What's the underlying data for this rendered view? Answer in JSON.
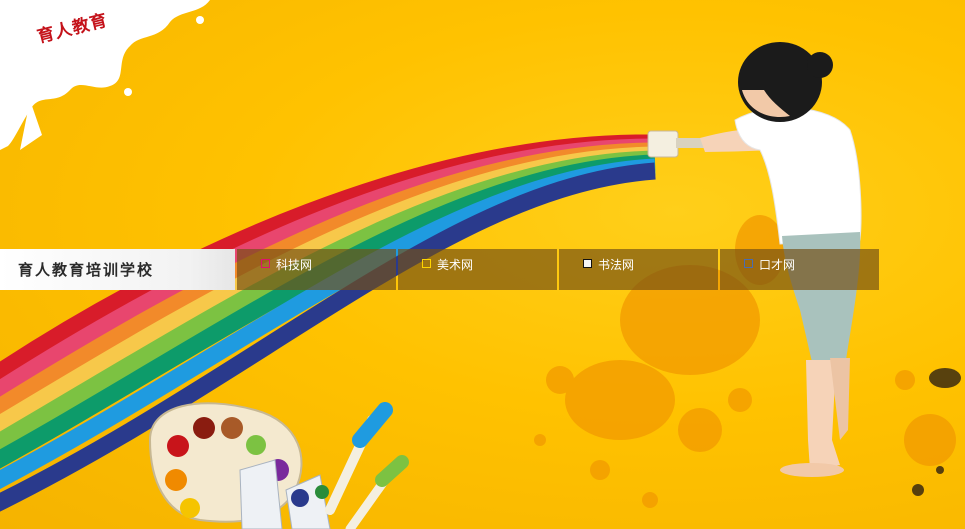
{
  "logo": {
    "text": "育人教育"
  },
  "header": {
    "school_name": "育人教育培训学校"
  },
  "nav": {
    "items": [
      {
        "label": "科技网",
        "marker_color": "#e0106e"
      },
      {
        "label": "美术网",
        "marker_color": "#ffd400"
      },
      {
        "label": "书法网",
        "marker_color": "#111111"
      },
      {
        "label": "口才网",
        "marker_color": "#4a6cb0"
      }
    ]
  },
  "colors": {
    "background": "#ffc200",
    "nav_overlay": "#735014",
    "logo_red": "#c4121a"
  },
  "illustration": {
    "rainbow_colors": [
      "#d81c2a",
      "#e8466e",
      "#f28a2a",
      "#f7c84a",
      "#7cc242",
      "#0d9b6a",
      "#1f9be0",
      "#2a3a8c"
    ],
    "palette_paint_colors": [
      "#c8141a",
      "#8a1c10",
      "#a85a28",
      "#f08a00",
      "#f5c400",
      "#7a2a9c",
      "#2a8c3a"
    ]
  }
}
